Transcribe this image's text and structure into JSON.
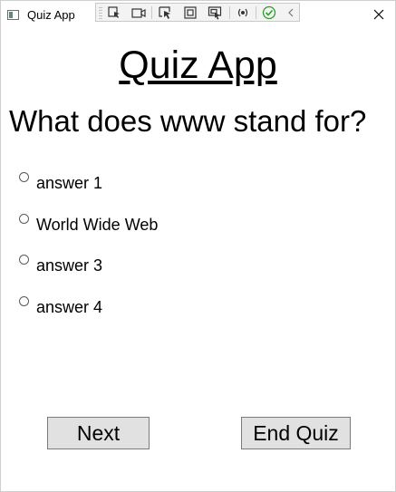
{
  "window": {
    "title": "Quiz App",
    "icon": "app-window-icon"
  },
  "toolbar": {
    "items": [
      "select-element-icon",
      "record-icon",
      "pointer-select-icon",
      "highlight-icon",
      "track-focus-icon",
      "binding-icon",
      "check-icon",
      "collapse-icon"
    ]
  },
  "header": {
    "title": "Quiz App"
  },
  "question": {
    "text": "What does www stand for?",
    "options": [
      {
        "label": "answer 1"
      },
      {
        "label": "World Wide Web"
      },
      {
        "label": "answer 3"
      },
      {
        "label": "answer 4"
      }
    ]
  },
  "actions": {
    "next_label": "Next",
    "end_label": "End Quiz"
  },
  "colors": {
    "button_bg": "#e1e1e1",
    "button_border": "#7a7a7a",
    "check_green": "#2aa02a"
  }
}
